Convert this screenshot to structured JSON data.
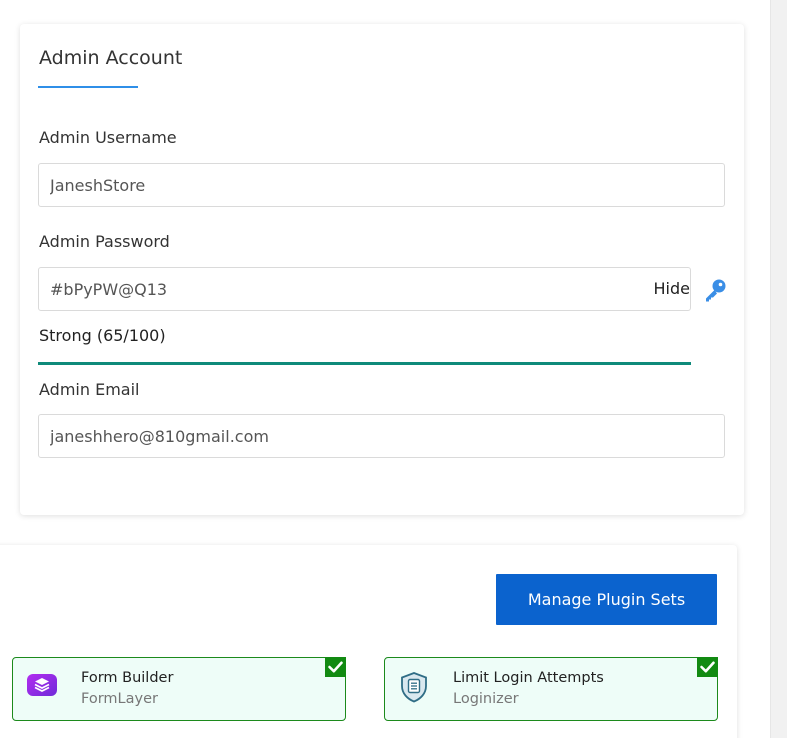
{
  "admin_account": {
    "title": "Admin Account",
    "username": {
      "label": "Admin Username",
      "value": "JaneshStore"
    },
    "password": {
      "label": "Admin Password",
      "value": "#bPyPW@Q13",
      "hide_label": "Hide",
      "strength_text": "Strong (65/100)",
      "strength_score": 65
    },
    "email": {
      "label": "Admin Email",
      "value": "janeshhero@810gmail.com"
    }
  },
  "plugins": {
    "manage_button_label": "Manage Plugin Sets",
    "items": [
      {
        "name": "Form Builder",
        "vendor": "FormLayer",
        "icon": "stack-layers-icon",
        "checked": true
      },
      {
        "name": "Limit Login Attempts",
        "vendor": "Loginizer",
        "icon": "shield-document-icon",
        "checked": true
      }
    ]
  },
  "colors": {
    "accent_blue": "#2f8fe8",
    "button_blue": "#0b63ce",
    "strength_teal": "#0f8a7a",
    "check_green": "#128a12",
    "plugin_bg": "#eefdf8"
  }
}
